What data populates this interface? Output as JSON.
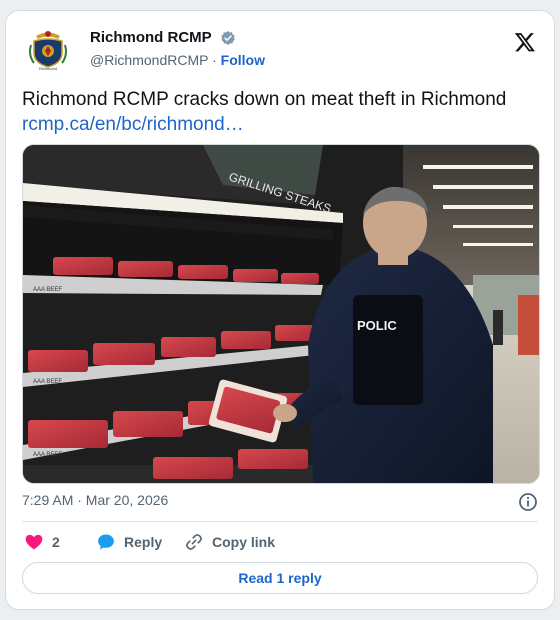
{
  "account": {
    "display_name": "Richmond RCMP",
    "handle": "@RichmondRCMP",
    "separator": "·",
    "follow_label": "Follow",
    "crest_text": "Richmond"
  },
  "tweet": {
    "text": "Richmond RCMP cracks down on meat theft in Richmond",
    "link": "rcmp.ca/en/bc/richmond…"
  },
  "photo": {
    "shelf_labels": [
      "AAA BEEF",
      "AAA BEEF",
      "AAA BEEF"
    ],
    "store_sign": "GRILLING STEAKS",
    "vest_text": "POLIC"
  },
  "meta": {
    "timestamp": "7:29 AM · Mar 20, 2026"
  },
  "actions": {
    "like_count": "2",
    "reply_label": "Reply",
    "copy_label": "Copy link"
  },
  "read_reply_label": "Read 1 reply",
  "colors": {
    "link_blue": "#1d65c9",
    "verified_gray": "#829aab",
    "heart_pink": "#f91880",
    "reply_blue": "#1d9bf0"
  }
}
